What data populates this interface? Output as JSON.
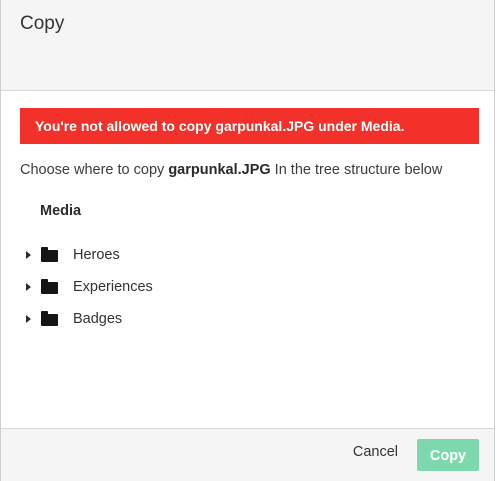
{
  "dialog": {
    "title": "Copy"
  },
  "alert": {
    "message": "You're not allowed to copy garpunkal.JPG under Media."
  },
  "instruction": {
    "prefix": "Choose where to copy ",
    "filename": "garpunkal.JPG",
    "suffix": " In the tree structure below"
  },
  "tree": {
    "root_label": "Media",
    "items": [
      {
        "label": "Heroes",
        "icon": "folder-icon"
      },
      {
        "label": "Experiences",
        "icon": "folder-icon"
      },
      {
        "label": "Badges",
        "icon": "folder-icon"
      }
    ]
  },
  "footer": {
    "cancel_label": "Cancel",
    "copy_label": "Copy"
  },
  "colors": {
    "alert_bg": "#f2312a",
    "copy_button_bg": "#7dd8ad",
    "header_bg": "#f5f5f5"
  }
}
